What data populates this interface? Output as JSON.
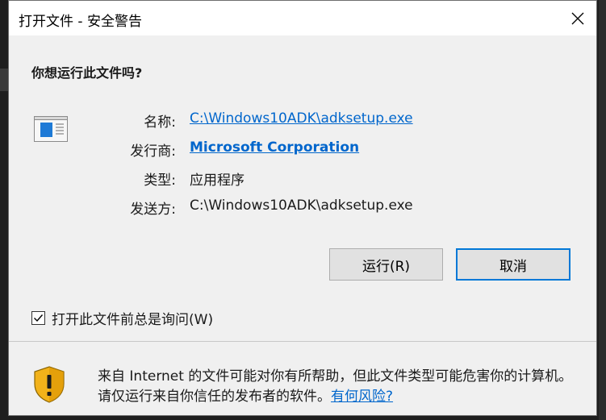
{
  "dialog": {
    "title": "打开文件 - 安全警告",
    "question": "你想运行此文件吗?",
    "fields": {
      "name_label": "名称:",
      "name_value": "C:\\Windows10ADK\\adksetup.exe",
      "publisher_label": "发行商:",
      "publisher_value": "Microsoft Corporation",
      "type_label": "类型:",
      "type_value": "应用程序",
      "from_label": "发送方:",
      "from_value": "C:\\Windows10ADK\\adksetup.exe"
    },
    "buttons": {
      "run_label": "运行(R)",
      "cancel_label": "取消"
    },
    "checkbox": {
      "label": "打开此文件前总是询问(W)",
      "checked": true
    },
    "warning": {
      "text": "来自 Internet 的文件可能对你有所帮助，但此文件类型可能危害你的计算机。请仅运行来自你信任的发布者的软件。",
      "link_label": "有何风险?"
    }
  },
  "colors": {
    "link": "#0066cc",
    "focus_border": "#0078d7",
    "dialog_bg": "#f0f0f0"
  },
  "icons": [
    "close-icon",
    "application-icon",
    "check-icon",
    "shield-warning-icon"
  ]
}
